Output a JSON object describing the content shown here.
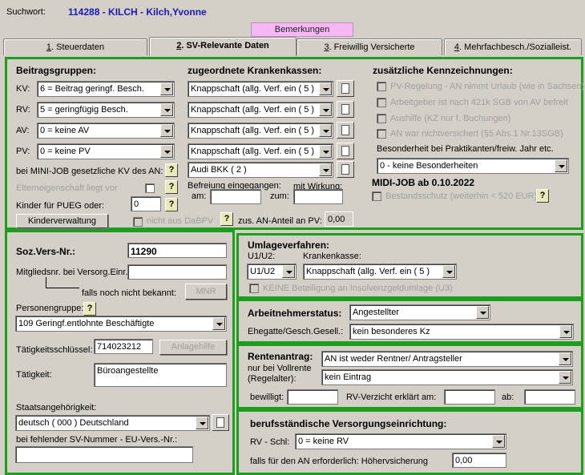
{
  "header": {
    "suchwort_label": "Suchwort:",
    "suchwort_value": "114288 - KILCH - Kilch,Yvonne",
    "bemerkungen_btn": "Bemerkungen"
  },
  "tabs": [
    {
      "num": "1",
      "label": ". Steuerdaten"
    },
    {
      "num": "2",
      "label": ". SV-Relevante Daten"
    },
    {
      "num": "3",
      "label": ". Freiwillig Versicherte"
    },
    {
      "num": "4",
      "label": ". Mehrfachbesch./Sozialleist."
    }
  ],
  "beitrag": {
    "title": "Beitragsgruppen:",
    "kv_label": "KV:",
    "kv_value": "6 = Beitrag geringf. Besch.",
    "rv_label": "RV:",
    "rv_value": "5 = geringfügig Besch.",
    "av_label": "AV:",
    "av_value": "0 = keine AV",
    "pv_label": "PV:",
    "pv_value": "0 = keine PV",
    "minijob_label": "bei MINI-JOB gesetzliche KV des AN:",
    "eltern_label": "Elterneigenschaft liegt vor",
    "kinder_label": "Kinder für  PUEG oder:",
    "kinder_value": "0",
    "kinderverwaltung_btn": "Kinderverwaltung"
  },
  "kassen": {
    "title": "zugeordnete Krankenkassen:",
    "kv": "Knappschaft (allg. Verf. ein ( 5 )",
    "rv": "Knappschaft (allg. Verf. ein ( 5 )",
    "av": "Knappschaft (allg. Verf. ein ( 5 )",
    "pv": "Knappschaft (allg. Verf. ein ( 5 )",
    "minijob": "Audi BKK ( 2 )",
    "befreiung_label": "Befreiung eingegangen:",
    "am_label": "am:",
    "wirkung_label": "mit Wirkung:",
    "zum_label": "zum:",
    "nicht_dabpv": "nicht aus DaBPV",
    "zus_an_label": "zus. AN-Anteil an PV:",
    "zus_an_value": "0,00"
  },
  "kennz": {
    "title": "zusätzliche Kennzeichnungen:",
    "items": [
      "PV-Regelung - AN nimmt Urlaub (wie in Sachsen)",
      "Arbeitgeber ist nach 421k SGB von AV befreit",
      "Aushilfe (KZ nur f. Buchungen)",
      "AN war nichtversichert (§5 Abs.1 Nr.13SGB)"
    ],
    "praktikanten_label": "Besonderheit bei Praktikanten/freiw. Jahr etc.",
    "praktikanten_value": "0 - keine Besonderheiten",
    "midi_title": "MIDI-JOB ab 0.10.2022",
    "bestandsschutz": "Bestandsschutz (weiterhin < 520 EUR)"
  },
  "person": {
    "sozvers_label": "Soz.Vers-Nr.:",
    "sozvers_value": "11290",
    "mitglied_label": "Mitgliedsnr. bei Versorg.Einr.:",
    "falls_label": "falls noch nicht bekannt:",
    "mnr_btn": "MNR",
    "personengruppe_label": "Personengruppe:",
    "personengruppe_value": "109  Geringf.entlohnte Beschäftigte",
    "taetigkeit_key_label": "Tätigkeitsschlüssel:",
    "taetigkeit_key_value": "714023212",
    "anlagehilfe_btn": "Anlagehilfe",
    "taetigkeit_label": "Tätigkeit:",
    "taetigkeit_value": "Büroangestellte",
    "staat_label": "Staatsangehörigkeit:",
    "staat_value": "deutsch ( 000 ) Deutschland",
    "eu_label": "bei fehlender SV-Nummer - EU-Vers.-Nr.:"
  },
  "umlage": {
    "title": "Umlageverfahren:",
    "u_label": "U1/U2:",
    "u_value": "U1/U2",
    "kasse_label": "Krankenkasse:",
    "kasse_value": "Knappschaft (allg. Verf. ein ( 5 )",
    "keine_insolvenz": "KEINE Beteiligung an Insolvenzgeldumlage (U3)"
  },
  "arbeitnehmer": {
    "status_label": "Arbeitnehmerstatus:",
    "status_value": "Angestellter",
    "ehegatte_label": "Ehegatte/Gesch.Gesell.:",
    "ehegatte_value": "kein besonderes Kz"
  },
  "rente": {
    "title": "Rentenantrag:",
    "antrag_value": "AN ist weder Rentner/ Antragsteller",
    "vollrente_label1": "nur bei Vollrente",
    "vollrente_label2": "(Regelalter):",
    "vollrente_value": "kein Eintrag",
    "bewilligt_label": "bewilligt:",
    "verzicht_label": "RV-Verzicht erklärt am:",
    "ab_label": "ab:"
  },
  "versorgung": {
    "title": "berufsständische Versorgungseinrichtung:",
    "rv_label": "RV - Schl:",
    "rv_value": "0 = keine RV",
    "hoeher_label": "falls für den AN erforderlich: Höhervsicherung",
    "hoeher_value": "0,00"
  }
}
